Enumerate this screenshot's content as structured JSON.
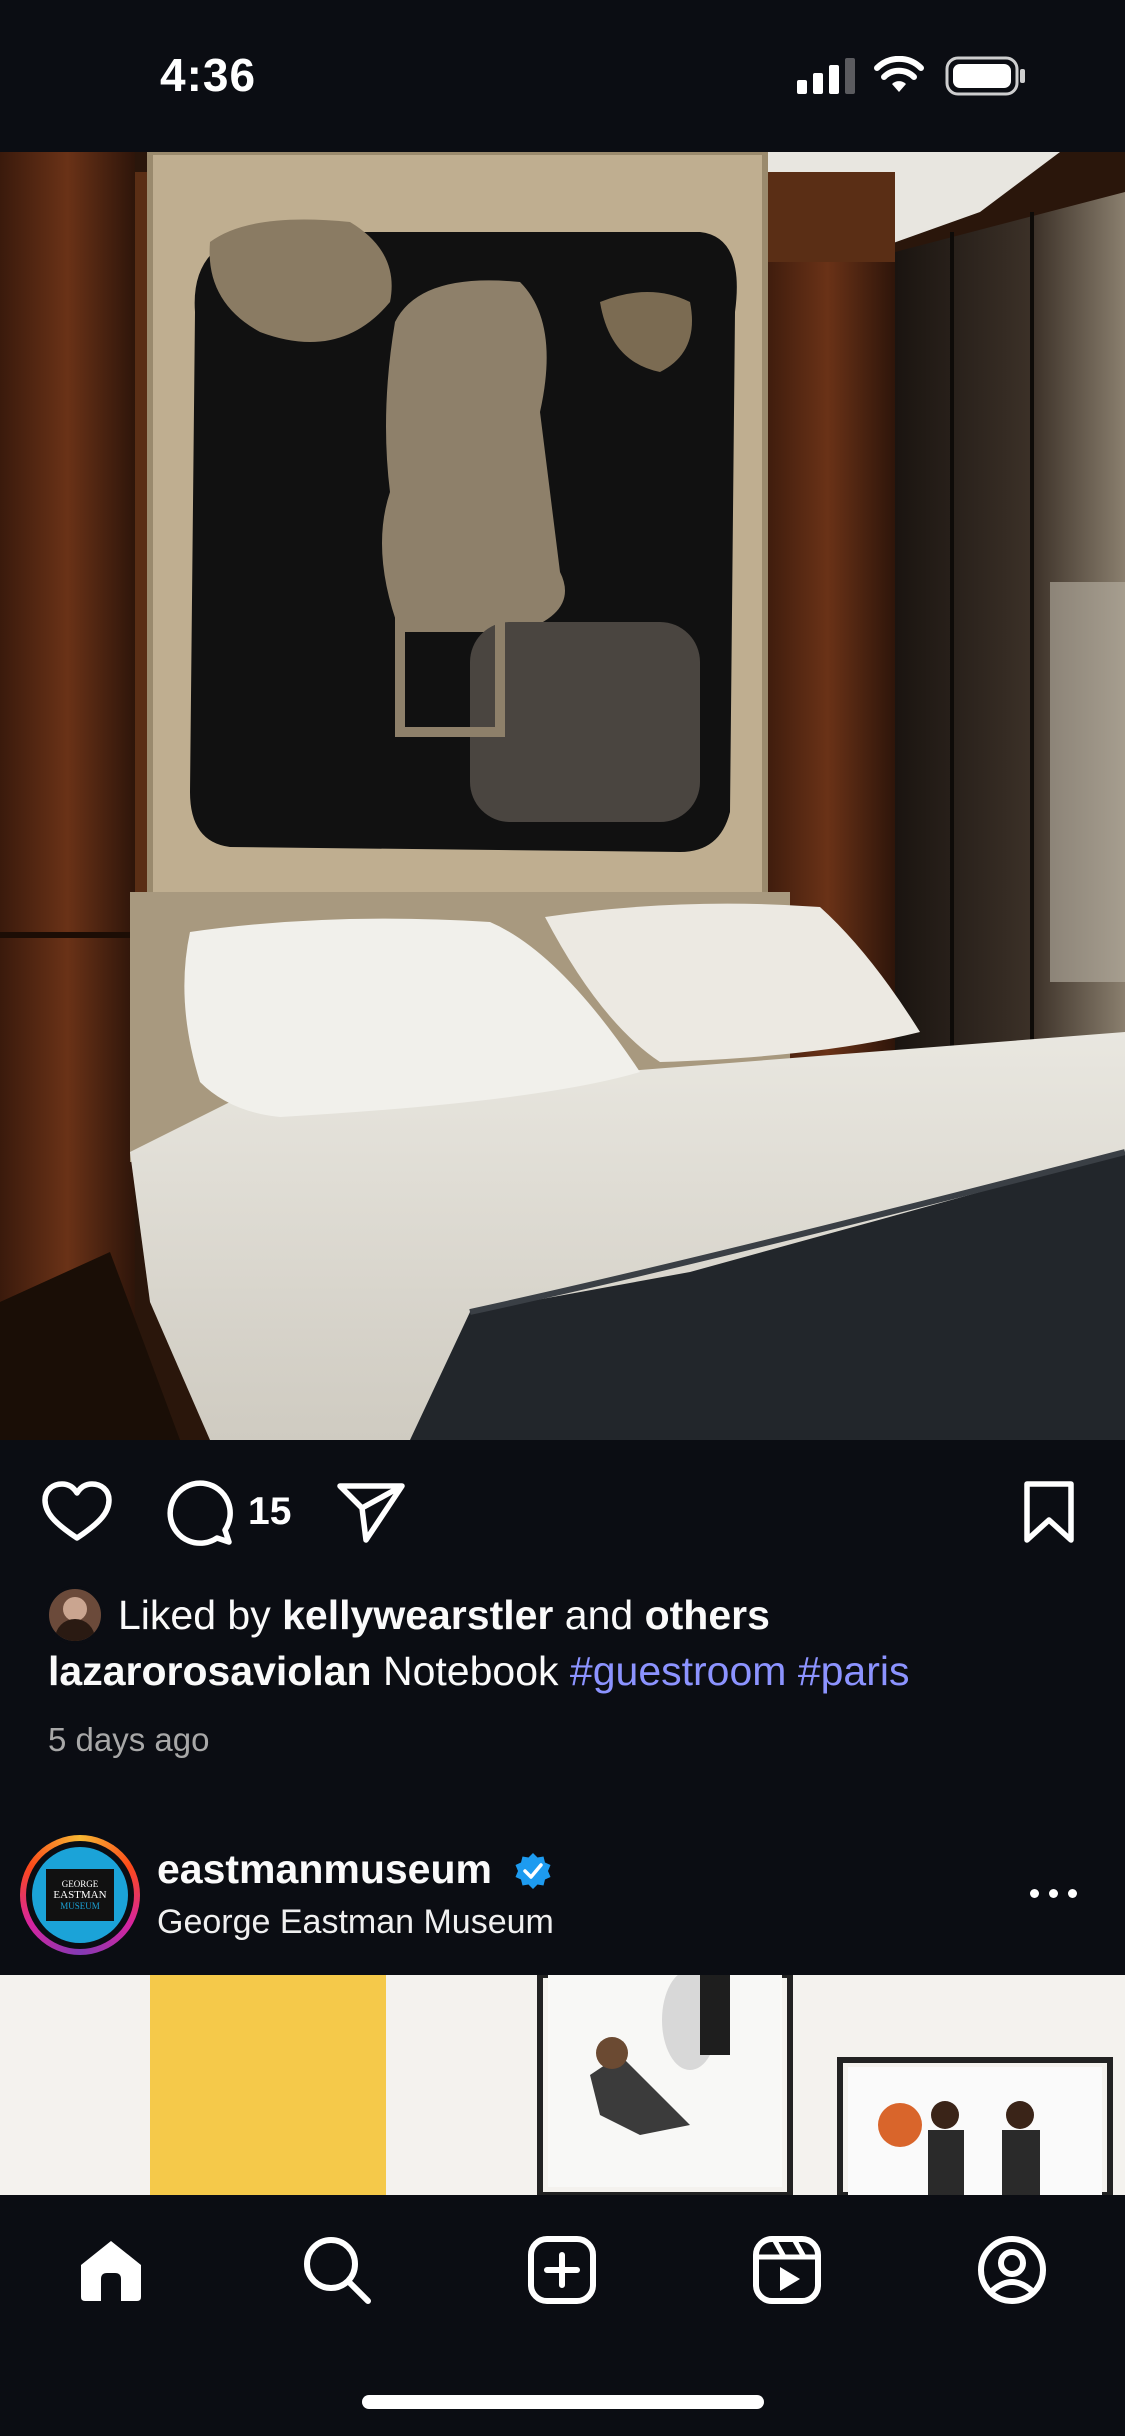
{
  "status_bar": {
    "time": "4:36",
    "icons": [
      "cellular-signal-icon",
      "wifi-icon",
      "battery-icon"
    ]
  },
  "post": {
    "image_alt_icon": "bedroom-photo",
    "actions": {
      "like_icon": "heart-icon",
      "comment_icon": "comment-icon",
      "comment_count": "15",
      "share_icon": "paper-plane-icon",
      "save_icon": "bookmark-icon"
    },
    "likes": {
      "prefix": "Liked by",
      "user": "kellywearstler",
      "connector": "and",
      "others": "others"
    },
    "caption": {
      "username": "lazarorosaviolan",
      "text": "Notebook",
      "tags": [
        "#guestroom",
        "#paris"
      ]
    },
    "time_ago": "5 days ago"
  },
  "next_post": {
    "username": "eastmanmuseum",
    "verified_icon": "verified-badge-icon",
    "subtitle": "George Eastman Museum",
    "avatar_lines": [
      "GEORGE",
      "EASTMAN",
      "MUSEUM"
    ],
    "more_icon": "more-options-icon"
  },
  "bottom_nav": {
    "items": [
      "home-icon",
      "search-icon",
      "create-post-icon",
      "reels-icon",
      "profile-icon"
    ]
  },
  "colors": {
    "background": "#0b0d13",
    "hashtag": "#8c93ff",
    "verified": "#1d9bf0",
    "secondary_text": "#a8a8a8"
  }
}
